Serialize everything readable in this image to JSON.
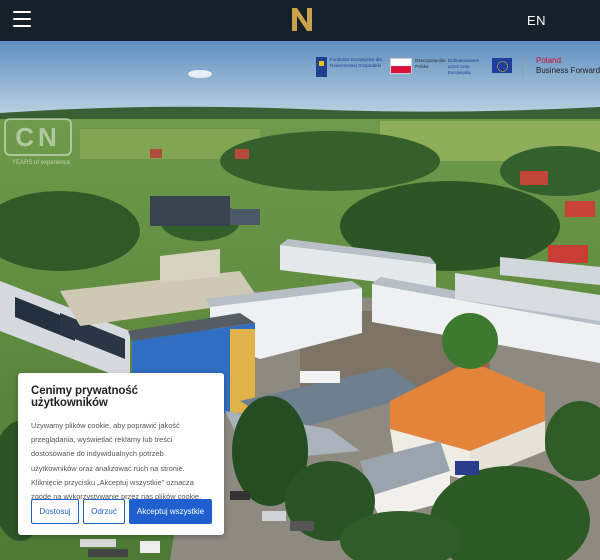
{
  "header": {
    "language": "EN",
    "menu_icon": "hamburger-icon",
    "logo_icon": "brand-logo-icon"
  },
  "funding": {
    "fe_text": "Fundusze Europejskie dla Nowoczesnej Gospodarki",
    "rp_text": "Rzeczpospolita Polska",
    "ue_text": "Dofinansowane przez Unię Europejską",
    "pbf_line1": "Poland.",
    "pbf_line2": "Business Forward"
  },
  "watermark": {
    "letters": "CN",
    "years": "YEARS of experience"
  },
  "cookie": {
    "title": "Cenimy prywatność użytkowników",
    "body": "Używamy plików cookie, aby poprawić jakość przeglądania, wyświetlać reklamy lub treści dostosowane do indywidualnych potrzeb użytkowników oraz analizować ruch na stronie. Kliknięcie przycisku „Akceptuj wszystkie\" oznacza zgodę na wykorzystywanie przez nas plików cookie.",
    "customize_label": "Dostosuj",
    "reject_label": "Odrzuć",
    "accept_label": "Akceptuj wszystkie"
  },
  "colors": {
    "header_bg": "#14212b",
    "logo_gold": "#c9a24a",
    "accent_blue": "#1f5fd0"
  }
}
